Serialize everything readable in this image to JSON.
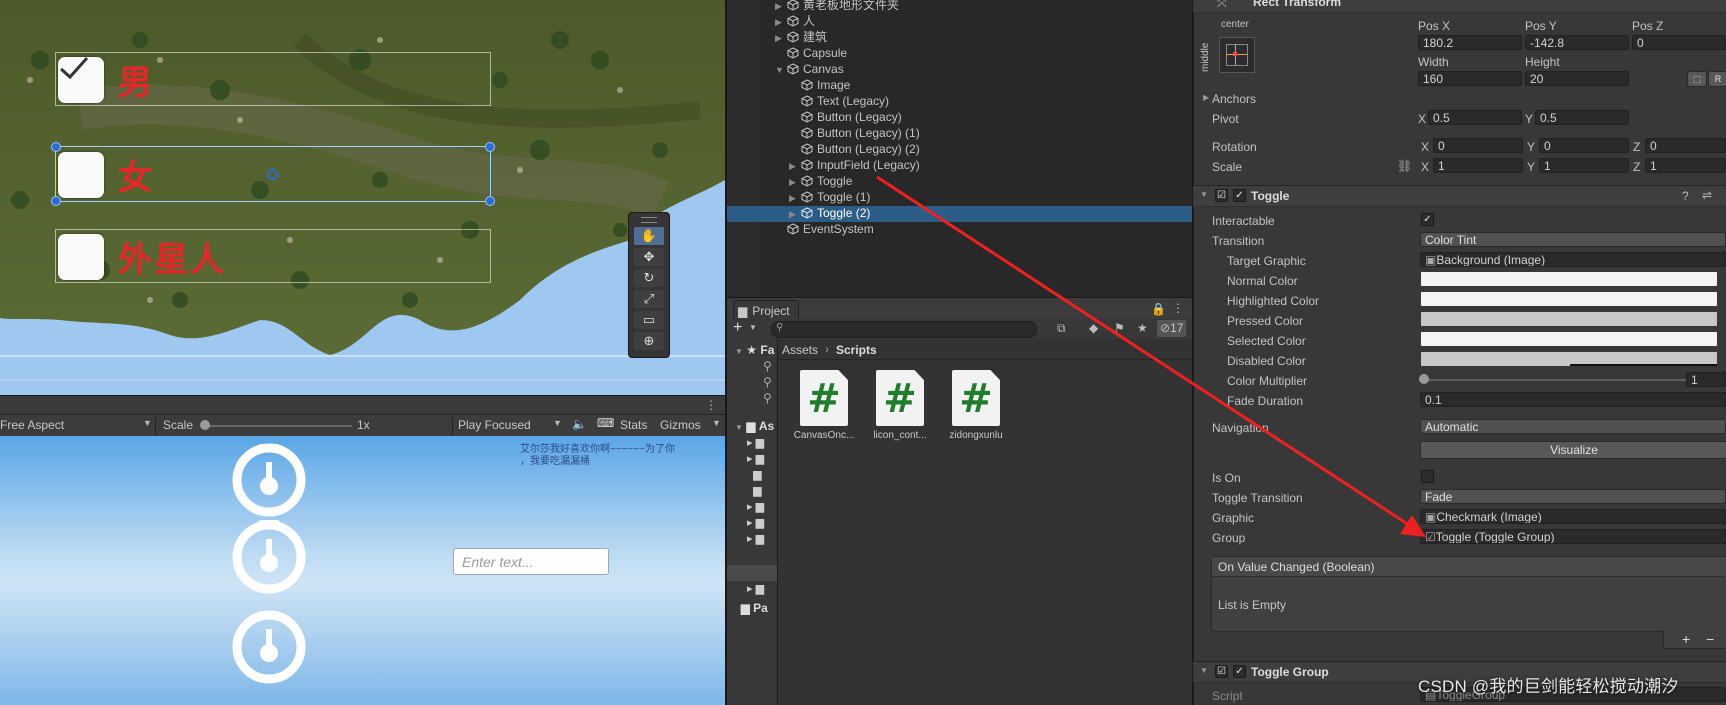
{
  "scene": {
    "toggles": [
      {
        "label": "男",
        "checked": true
      },
      {
        "label": "女",
        "checked": false
      },
      {
        "label": "外星人",
        "checked": false
      }
    ],
    "tools": [
      "hand-tool",
      "move-tool",
      "rotate-tool",
      "scale-tool",
      "rect-tool",
      "transform-tool"
    ]
  },
  "game_toolbar": {
    "aspect": "Free Aspect",
    "scale_label": "Scale",
    "scale_value": "1x",
    "play_mode": "Play Focused",
    "stats": "Stats",
    "gizmos": "Gizmos"
  },
  "game": {
    "input_placeholder": "Enter text...",
    "text_line1": "艾尔莎我好喜欢你啊~~~~~~为了你",
    "text_line2": "，我要吃漏漏桶"
  },
  "hierarchy": {
    "items": [
      {
        "label": "黄老板地形文件夹",
        "expand": true,
        "indent": 0
      },
      {
        "label": "人",
        "expand": true,
        "indent": 0
      },
      {
        "label": "建筑",
        "expand": true,
        "indent": 0
      },
      {
        "label": "Capsule",
        "expand": false,
        "indent": 0
      },
      {
        "label": "Canvas",
        "expand": true,
        "indent": 0,
        "open": true
      },
      {
        "label": "Image",
        "expand": false,
        "indent": 1
      },
      {
        "label": "Text (Legacy)",
        "expand": false,
        "indent": 1
      },
      {
        "label": "Button (Legacy)",
        "expand": false,
        "indent": 1
      },
      {
        "label": "Button (Legacy) (1)",
        "expand": false,
        "indent": 1
      },
      {
        "label": "Button (Legacy) (2)",
        "expand": false,
        "indent": 1
      },
      {
        "label": "InputField (Legacy)",
        "expand": true,
        "indent": 1
      },
      {
        "label": "Toggle",
        "expand": true,
        "indent": 1
      },
      {
        "label": "Toggle (1)",
        "expand": true,
        "indent": 1
      },
      {
        "label": "Toggle (2)",
        "expand": true,
        "indent": 1,
        "selected": true
      },
      {
        "label": "EventSystem",
        "expand": false,
        "indent": 0
      }
    ]
  },
  "project": {
    "tab": "Project",
    "hidden_count": "17",
    "breadcrumb": [
      "Assets",
      "Scripts"
    ],
    "left_items": [
      "Fa",
      "As",
      "Pa"
    ],
    "assets": [
      {
        "name": "CanvasOnc..."
      },
      {
        "name": "licon_cont..."
      },
      {
        "name": "zidongxunlu"
      }
    ]
  },
  "inspector": {
    "rect_transform": {
      "title": "Rect Transform",
      "anchor_preset_top": "center",
      "anchor_preset_side": "middle",
      "pos_x_label": "Pos X",
      "pos_x": "180.2",
      "pos_y_label": "Pos Y",
      "pos_y": "-142.8",
      "pos_z_label": "Pos Z",
      "pos_z": "0",
      "width_label": "Width",
      "width": "160",
      "height_label": "Height",
      "height": "20",
      "anchors": "Anchors",
      "pivot": "Pivot",
      "pivot_x": "0.5",
      "pivot_y": "0.5",
      "rotation": "Rotation",
      "rot_x": "0",
      "rot_y": "0",
      "rot_z": "0",
      "scale": "Scale",
      "scale_x": "1",
      "scale_y": "1",
      "scale_z": "1",
      "x": "X",
      "y": "Y",
      "z": "Z",
      "r_button": "R"
    },
    "toggle": {
      "title": "Toggle",
      "interactable": "Interactable",
      "transition": "Transition",
      "transition_value": "Color Tint",
      "target_graphic": "Target Graphic",
      "target_graphic_value": "Background (Image)",
      "normal_color": "Normal Color",
      "highlighted_color": "Highlighted Color",
      "pressed_color": "Pressed Color",
      "selected_color": "Selected Color",
      "disabled_color": "Disabled Color",
      "color_multiplier": "Color Multiplier",
      "color_multiplier_value": "1",
      "fade_duration": "Fade Duration",
      "fade_duration_value": "0.1",
      "navigation": "Navigation",
      "navigation_value": "Automatic",
      "visualize": "Visualize",
      "is_on": "Is On",
      "toggle_transition": "Toggle Transition",
      "toggle_transition_value": "Fade",
      "graphic": "Graphic",
      "graphic_value": "Checkmark (Image)",
      "group": "Group",
      "group_value": "Toggle (Toggle Group)",
      "event_header": "On Value Changed (Boolean)",
      "event_empty": "List is Empty",
      "plus": "+",
      "minus": "−"
    },
    "toggle_group": {
      "title": "Toggle Group",
      "script": "Script",
      "script_value": "ToggleGroup"
    },
    "colors": {
      "normal": "#ffffff",
      "highlighted": "#f5f5f5",
      "pressed": "#c8c8c8",
      "selected": "#f5f5f5",
      "disabled": "#c8c8c8"
    }
  },
  "watermark": "CSDN @我的巨剑能轻松搅动潮汐"
}
